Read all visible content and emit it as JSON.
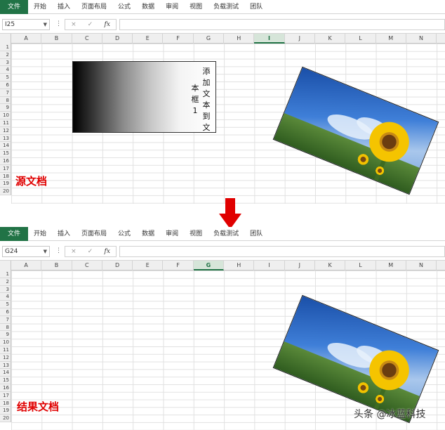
{
  "ribbon_tabs": [
    "文件",
    "开始",
    "插入",
    "页面布局",
    "公式",
    "数据",
    "审阅",
    "视图",
    "负载测试",
    "团队"
  ],
  "top": {
    "name_box": "I25",
    "columns": [
      "A",
      "B",
      "C",
      "D",
      "E",
      "F",
      "G",
      "H",
      "I",
      "J",
      "K",
      "L",
      "M",
      "N"
    ],
    "selected_column": "I",
    "rows": [
      "1",
      "2",
      "3",
      "4",
      "5",
      "6",
      "7",
      "8",
      "9",
      "10",
      "11",
      "12",
      "13",
      "14",
      "15",
      "16",
      "17",
      "18",
      "19",
      "20"
    ],
    "textbox_col1": [
      "添",
      "加",
      "文",
      "本",
      "到",
      "文"
    ],
    "textbox_col2": [
      "本",
      "框",
      "1"
    ],
    "label": "源文档"
  },
  "bottom": {
    "name_box": "G24",
    "columns": [
      "A",
      "B",
      "C",
      "D",
      "E",
      "F",
      "G",
      "H",
      "I",
      "J",
      "K",
      "L",
      "M",
      "N"
    ],
    "selected_column": "G",
    "rows": [
      "1",
      "2",
      "3",
      "4",
      "5",
      "6",
      "7",
      "8",
      "9",
      "10",
      "11",
      "12",
      "13",
      "14",
      "15",
      "16",
      "17",
      "18",
      "19",
      "20"
    ],
    "label": "结果文档"
  },
  "formula_icons": {
    "cancel": "×",
    "enter": "✓",
    "fx": "fx"
  },
  "watermark": "头条 @冰蓝科技",
  "colors": {
    "excel_green": "#217346",
    "label_red": "#e00000",
    "arrow_red": "#e00000"
  }
}
